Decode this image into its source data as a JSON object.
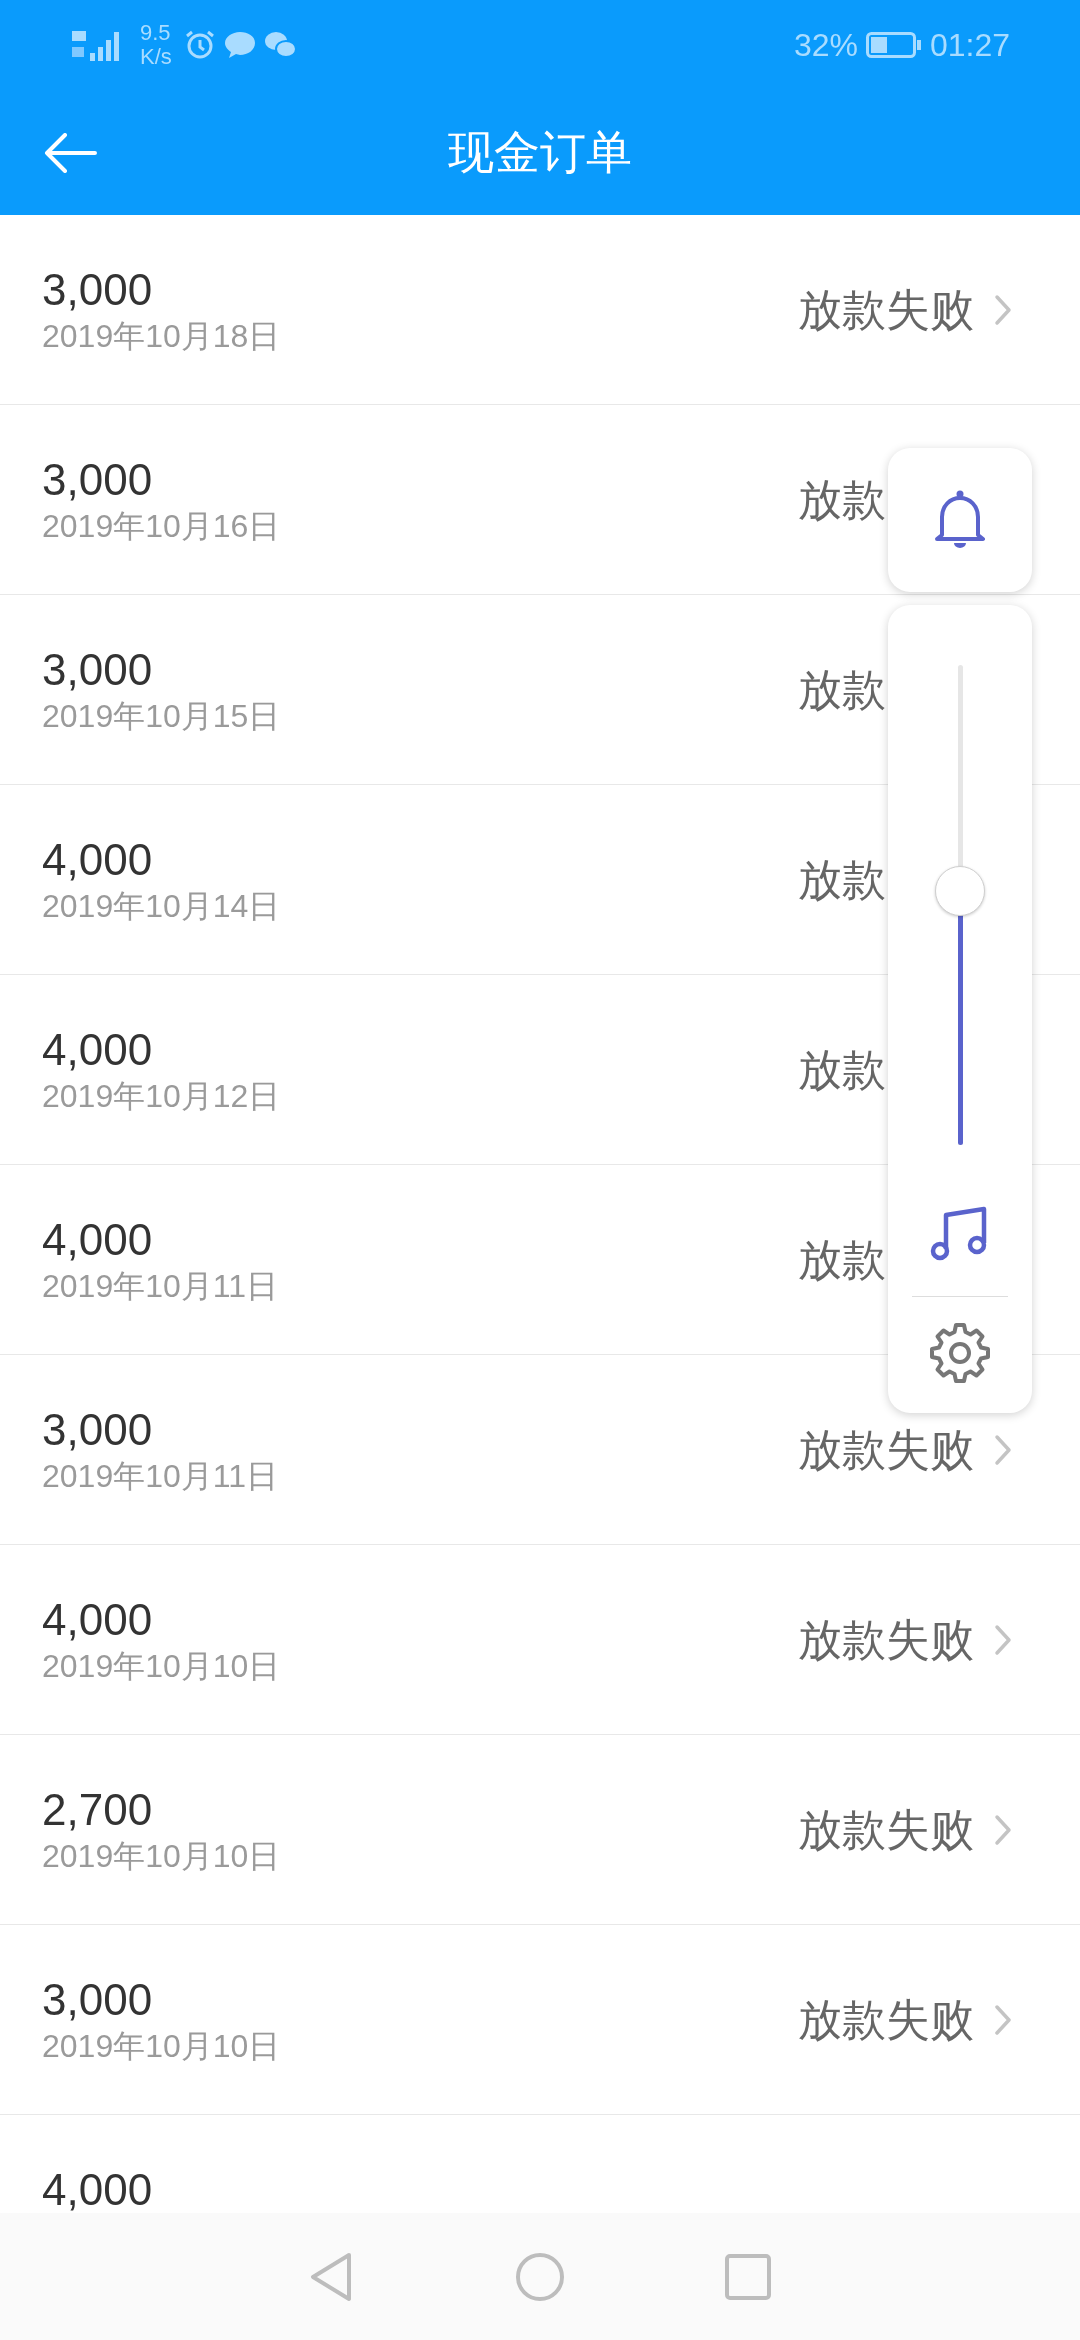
{
  "status_bar": {
    "speed_value": "9.5",
    "speed_unit": "K/s",
    "battery": "32%",
    "time": "01:27"
  },
  "header": {
    "title": "现金订单"
  },
  "orders": [
    {
      "amount": "3,000",
      "date": "2019年10月18日",
      "status": "放款失败",
      "show_arrow": true
    },
    {
      "amount": "3,000",
      "date": "2019年10月16日",
      "status": "放款",
      "show_arrow": false
    },
    {
      "amount": "3,000",
      "date": "2019年10月15日",
      "status": "放款",
      "show_arrow": false
    },
    {
      "amount": "4,000",
      "date": "2019年10月14日",
      "status": "放款",
      "show_arrow": false
    },
    {
      "amount": "4,000",
      "date": "2019年10月12日",
      "status": "放款",
      "show_arrow": false
    },
    {
      "amount": "4,000",
      "date": "2019年10月11日",
      "status": "放款",
      "show_arrow": false
    },
    {
      "amount": "3,000",
      "date": "2019年10月11日",
      "status": "放款失败",
      "show_arrow": true
    },
    {
      "amount": "4,000",
      "date": "2019年10月10日",
      "status": "放款失败",
      "show_arrow": true
    },
    {
      "amount": "2,700",
      "date": "2019年10月10日",
      "status": "放款失败",
      "show_arrow": true
    },
    {
      "amount": "3,000",
      "date": "2019年10月10日",
      "status": "放款失败",
      "show_arrow": true
    },
    {
      "amount": "4,000"
    }
  ],
  "volume_panel": {
    "level": 0.53
  }
}
